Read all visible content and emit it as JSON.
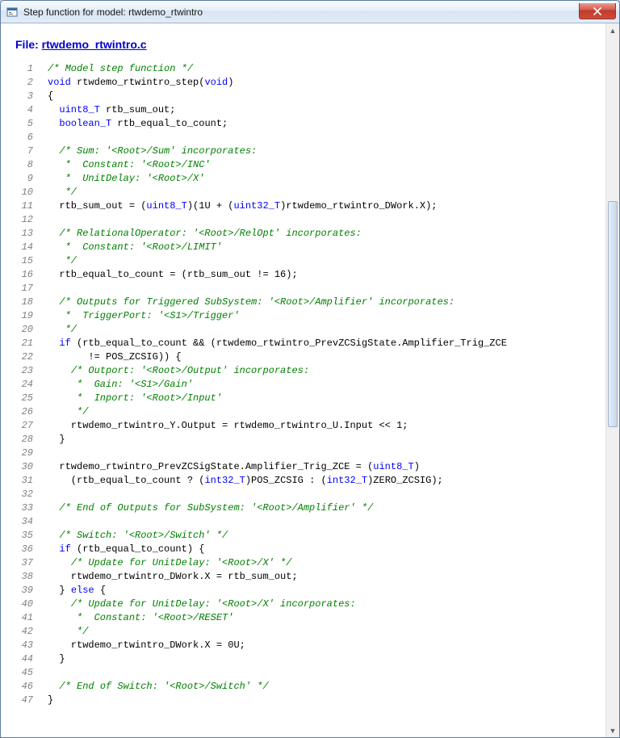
{
  "window": {
    "title": "Step function for model: rtwdemo_rtwintro",
    "close_icon": "close-icon"
  },
  "header": {
    "file_label": "File: ",
    "file_link": "rtwdemo_rtwintro.c"
  },
  "code_lines": [
    {
      "n": 1,
      "tokens": [
        {
          "t": "/* Model step function */",
          "c": "c-comment"
        }
      ]
    },
    {
      "n": 2,
      "tokens": [
        {
          "t": "void",
          "c": "c-keyword"
        },
        {
          "t": " rtwdemo_rtwintro_step("
        },
        {
          "t": "void",
          "c": "c-keyword"
        },
        {
          "t": ")"
        }
      ]
    },
    {
      "n": 3,
      "tokens": [
        {
          "t": "{"
        }
      ]
    },
    {
      "n": 4,
      "tokens": [
        {
          "t": "  "
        },
        {
          "t": "uint8_T",
          "c": "c-type"
        },
        {
          "t": " rtb_sum_out;"
        }
      ]
    },
    {
      "n": 5,
      "tokens": [
        {
          "t": "  "
        },
        {
          "t": "boolean_T",
          "c": "c-type"
        },
        {
          "t": " rtb_equal_to_count;"
        }
      ]
    },
    {
      "n": 6,
      "tokens": [
        {
          "t": ""
        }
      ]
    },
    {
      "n": 7,
      "tokens": [
        {
          "t": "  "
        },
        {
          "t": "/* Sum: '<Root>/Sum' incorporates:",
          "c": "c-comment"
        }
      ]
    },
    {
      "n": 8,
      "tokens": [
        {
          "t": "   *  Constant: '<Root>/INC'",
          "c": "c-comment"
        }
      ]
    },
    {
      "n": 9,
      "tokens": [
        {
          "t": "   *  UnitDelay: '<Root>/X'",
          "c": "c-comment"
        }
      ]
    },
    {
      "n": 10,
      "tokens": [
        {
          "t": "   */",
          "c": "c-comment"
        }
      ]
    },
    {
      "n": 11,
      "tokens": [
        {
          "t": "  rtb_sum_out = ("
        },
        {
          "t": "uint8_T",
          "c": "c-type"
        },
        {
          "t": ")(1U + ("
        },
        {
          "t": "uint32_T",
          "c": "c-type"
        },
        {
          "t": ")rtwdemo_rtwintro_DWork.X);"
        }
      ]
    },
    {
      "n": 12,
      "tokens": [
        {
          "t": ""
        }
      ]
    },
    {
      "n": 13,
      "tokens": [
        {
          "t": "  "
        },
        {
          "t": "/* RelationalOperator: '<Root>/RelOpt' incorporates:",
          "c": "c-comment"
        }
      ]
    },
    {
      "n": 14,
      "tokens": [
        {
          "t": "   *  Constant: '<Root>/LIMIT'",
          "c": "c-comment"
        }
      ]
    },
    {
      "n": 15,
      "tokens": [
        {
          "t": "   */",
          "c": "c-comment"
        }
      ]
    },
    {
      "n": 16,
      "tokens": [
        {
          "t": "  rtb_equal_to_count = (rtb_sum_out != 16);"
        }
      ]
    },
    {
      "n": 17,
      "tokens": [
        {
          "t": ""
        }
      ]
    },
    {
      "n": 18,
      "tokens": [
        {
          "t": "  "
        },
        {
          "t": "/* Outputs for Triggered SubSystem: '<Root>/Amplifier' incorporates:",
          "c": "c-comment"
        }
      ]
    },
    {
      "n": 19,
      "tokens": [
        {
          "t": "   *  TriggerPort: '<S1>/Trigger'",
          "c": "c-comment"
        }
      ]
    },
    {
      "n": 20,
      "tokens": [
        {
          "t": "   */",
          "c": "c-comment"
        }
      ]
    },
    {
      "n": 21,
      "tokens": [
        {
          "t": "  "
        },
        {
          "t": "if",
          "c": "c-keyword"
        },
        {
          "t": " (rtb_equal_to_count && (rtwdemo_rtwintro_PrevZCSigState.Amplifier_Trig_ZCE"
        }
      ]
    },
    {
      "n": 22,
      "tokens": [
        {
          "t": "       != POS_ZCSIG)) {"
        }
      ]
    },
    {
      "n": 23,
      "tokens": [
        {
          "t": "    "
        },
        {
          "t": "/* Outport: '<Root>/Output' incorporates:",
          "c": "c-comment"
        }
      ]
    },
    {
      "n": 24,
      "tokens": [
        {
          "t": "     *  Gain: '<S1>/Gain'",
          "c": "c-comment"
        }
      ]
    },
    {
      "n": 25,
      "tokens": [
        {
          "t": "     *  Inport: '<Root>/Input'",
          "c": "c-comment"
        }
      ]
    },
    {
      "n": 26,
      "tokens": [
        {
          "t": "     */",
          "c": "c-comment"
        }
      ]
    },
    {
      "n": 27,
      "tokens": [
        {
          "t": "    rtwdemo_rtwintro_Y.Output = rtwdemo_rtwintro_U.Input << 1;"
        }
      ]
    },
    {
      "n": 28,
      "tokens": [
        {
          "t": "  }"
        }
      ]
    },
    {
      "n": 29,
      "tokens": [
        {
          "t": ""
        }
      ]
    },
    {
      "n": 30,
      "tokens": [
        {
          "t": "  rtwdemo_rtwintro_PrevZCSigState.Amplifier_Trig_ZCE = ("
        },
        {
          "t": "uint8_T",
          "c": "c-type"
        },
        {
          "t": ")"
        }
      ]
    },
    {
      "n": 31,
      "tokens": [
        {
          "t": "    (rtb_equal_to_count ? ("
        },
        {
          "t": "int32_T",
          "c": "c-type"
        },
        {
          "t": ")POS_ZCSIG : ("
        },
        {
          "t": "int32_T",
          "c": "c-type"
        },
        {
          "t": ")ZERO_ZCSIG);"
        }
      ]
    },
    {
      "n": 32,
      "tokens": [
        {
          "t": ""
        }
      ]
    },
    {
      "n": 33,
      "tokens": [
        {
          "t": "  "
        },
        {
          "t": "/* End of Outputs for SubSystem: '<Root>/Amplifier' */",
          "c": "c-comment"
        }
      ]
    },
    {
      "n": 34,
      "tokens": [
        {
          "t": ""
        }
      ]
    },
    {
      "n": 35,
      "tokens": [
        {
          "t": "  "
        },
        {
          "t": "/* Switch: '<Root>/Switch' */",
          "c": "c-comment"
        }
      ]
    },
    {
      "n": 36,
      "tokens": [
        {
          "t": "  "
        },
        {
          "t": "if",
          "c": "c-keyword"
        },
        {
          "t": " (rtb_equal_to_count) {"
        }
      ]
    },
    {
      "n": 37,
      "tokens": [
        {
          "t": "    "
        },
        {
          "t": "/* Update for UnitDelay: '<Root>/X' */",
          "c": "c-comment"
        }
      ]
    },
    {
      "n": 38,
      "tokens": [
        {
          "t": "    rtwdemo_rtwintro_DWork.X = rtb_sum_out;"
        }
      ]
    },
    {
      "n": 39,
      "tokens": [
        {
          "t": "  } "
        },
        {
          "t": "else",
          "c": "c-keyword"
        },
        {
          "t": " {"
        }
      ]
    },
    {
      "n": 40,
      "tokens": [
        {
          "t": "    "
        },
        {
          "t": "/* Update for UnitDelay: '<Root>/X' incorporates:",
          "c": "c-comment"
        }
      ]
    },
    {
      "n": 41,
      "tokens": [
        {
          "t": "     *  Constant: '<Root>/RESET'",
          "c": "c-comment"
        }
      ]
    },
    {
      "n": 42,
      "tokens": [
        {
          "t": "     */",
          "c": "c-comment"
        }
      ]
    },
    {
      "n": 43,
      "tokens": [
        {
          "t": "    rtwdemo_rtwintro_DWork.X = 0U;"
        }
      ]
    },
    {
      "n": 44,
      "tokens": [
        {
          "t": "  }"
        }
      ]
    },
    {
      "n": 45,
      "tokens": [
        {
          "t": ""
        }
      ]
    },
    {
      "n": 46,
      "tokens": [
        {
          "t": "  "
        },
        {
          "t": "/* End of Switch: '<Root>/Switch' */",
          "c": "c-comment"
        }
      ]
    },
    {
      "n": 47,
      "tokens": [
        {
          "t": "}"
        }
      ]
    }
  ]
}
